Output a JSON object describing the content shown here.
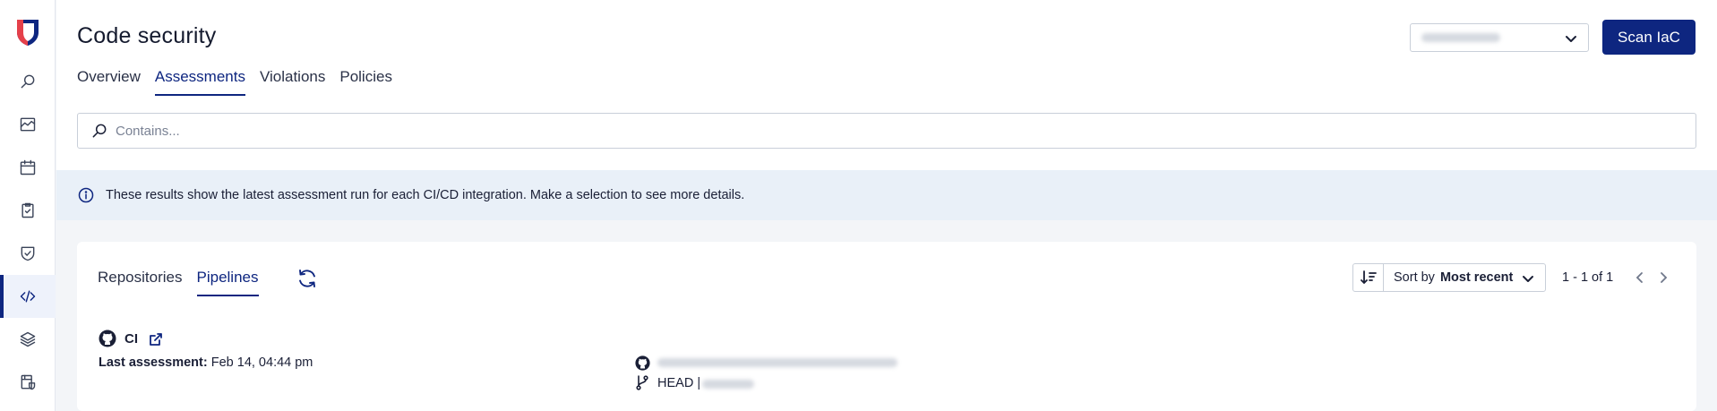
{
  "sidebar": {
    "logo": "shield-logo",
    "items": [
      {
        "icon": "search-icon",
        "active": false
      },
      {
        "icon": "chart-icon",
        "active": false
      },
      {
        "icon": "calendar-icon",
        "active": false
      },
      {
        "icon": "clipboard-check-icon",
        "active": false
      },
      {
        "icon": "shield-check-icon",
        "active": false
      },
      {
        "icon": "code-icon",
        "active": true
      },
      {
        "icon": "layers-icon",
        "active": false
      },
      {
        "icon": "database-shield-icon",
        "active": false
      }
    ]
  },
  "header": {
    "title": "Code security",
    "tabs": [
      {
        "label": "Overview",
        "active": false
      },
      {
        "label": "Assessments",
        "active": true
      },
      {
        "label": "Violations",
        "active": false
      },
      {
        "label": "Policies",
        "active": false
      }
    ],
    "select_value": "",
    "scan_button": "Scan IaC"
  },
  "search": {
    "placeholder": "Contains..."
  },
  "banner": {
    "text": "These results show the latest assessment run for each CI/CD integration. Make a selection to see more details."
  },
  "card": {
    "sub_tabs": [
      {
        "label": "Repositories",
        "active": false
      },
      {
        "label": "Pipelines",
        "active": true
      }
    ],
    "sort": {
      "label": "Sort by",
      "value": "Most recent"
    },
    "pager": "1 - 1 of 1",
    "items": [
      {
        "name": "CI",
        "last_assessment_label": "Last assessment:",
        "last_assessment_value": "Feb 14, 04:44 pm",
        "branch": "HEAD |"
      }
    ]
  },
  "colors": {
    "accent": "#0e2680",
    "banner_bg": "#e9f0f8",
    "page_bg": "#f3f5f8"
  }
}
